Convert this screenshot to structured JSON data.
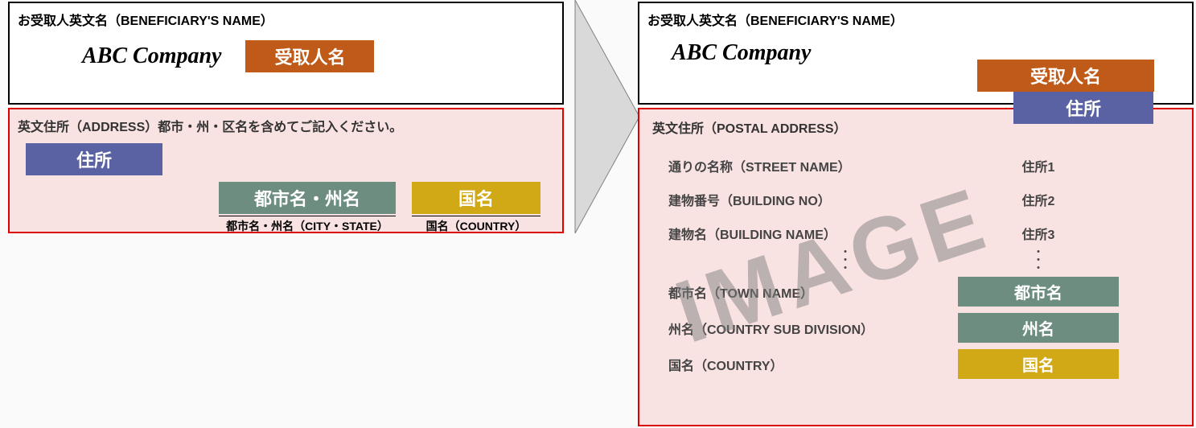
{
  "left": {
    "name_header": "お受取人英文名（BENEFICIARY'S NAME）",
    "company": "ABC Company",
    "tag_name": "受取人名",
    "addr_header": "英文住所（ADDRESS）都市・州・区名を含めてご記入ください。",
    "tag_addr": "住所",
    "tag_city": "都市名・州名",
    "tag_country": "国名",
    "sub_city": "都市名・州名（CITY・STATE）",
    "sub_country": "国名（COUNTRY）"
  },
  "right": {
    "name_header": "お受取人英文名（BENEFICIARY'S NAME）",
    "company": "ABC Company",
    "tag_name": "受取人名",
    "tag_addr": "住所",
    "addr_header": "英文住所（POSTAL ADDRESS）",
    "rows": [
      {
        "label": "通りの名称（STREET NAME）",
        "value": "住所1"
      },
      {
        "label": "建物番号（BUILDING NO）",
        "value": "住所2"
      },
      {
        "label": "建物名（BUILDING NAME）",
        "value": "住所3"
      }
    ],
    "town_label": "都市名（TOWN NAME）",
    "state_label": "州名（COUNTRY SUB DIVISION）",
    "country_label": "国名（COUNTRY）",
    "tag_town": "都市名",
    "tag_state": "州名",
    "tag_country": "国名",
    "watermark": "IMAGE"
  }
}
